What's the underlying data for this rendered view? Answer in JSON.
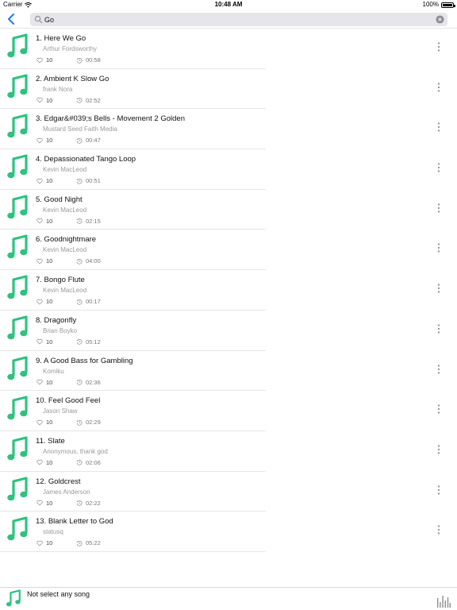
{
  "status_bar": {
    "carrier": "Carrier",
    "time": "10:48 AM",
    "battery": "100%"
  },
  "search": {
    "value": "Go"
  },
  "songs": [
    {
      "title": "1. Here We Go",
      "artist": "Arthur Fordsworthy",
      "likes": "10",
      "duration": "00:58"
    },
    {
      "title": "2. Ambient K Slow Go",
      "artist": "frank Nora",
      "likes": "10",
      "duration": "02:52"
    },
    {
      "title": "3. Edgar&#039;s Bells - Movement 2 Golden",
      "artist": "Mustard Seed Faith Media",
      "likes": "10",
      "duration": "00:47"
    },
    {
      "title": "4. Depassionated Tango Loop",
      "artist": "Kevin MacLeod",
      "likes": "10",
      "duration": "00:51"
    },
    {
      "title": "5. Good Night",
      "artist": "Kevin MacLeod",
      "likes": "10",
      "duration": "02:15"
    },
    {
      "title": "6. Goodnightmare",
      "artist": "Kevin MacLeod",
      "likes": "10",
      "duration": "04:00"
    },
    {
      "title": "7. Bongo Flute",
      "artist": "Kevin MacLeod",
      "likes": "10",
      "duration": "00:17"
    },
    {
      "title": "8. Dragonfly",
      "artist": "Brian Boyko",
      "likes": "10",
      "duration": "05:12"
    },
    {
      "title": "9. A Good Bass for Gambling",
      "artist": "Komiku",
      "likes": "10",
      "duration": "02:36"
    },
    {
      "title": "10. Feel Good Feel",
      "artist": "Jason Shaw",
      "likes": "10",
      "duration": "02:29"
    },
    {
      "title": "11. Slate",
      "artist": "Anonymous, thank god",
      "likes": "10",
      "duration": "02:06"
    },
    {
      "title": "12. Goldcrest",
      "artist": "James Anderson",
      "likes": "10",
      "duration": "02:22"
    },
    {
      "title": "13. Blank Letter to God",
      "artist": "statusq",
      "likes": "10",
      "duration": "05:22"
    }
  ],
  "player": {
    "now_playing": "Not select any song"
  },
  "colors": {
    "accent": "#2ec27e",
    "back": "#1a7cf5"
  }
}
